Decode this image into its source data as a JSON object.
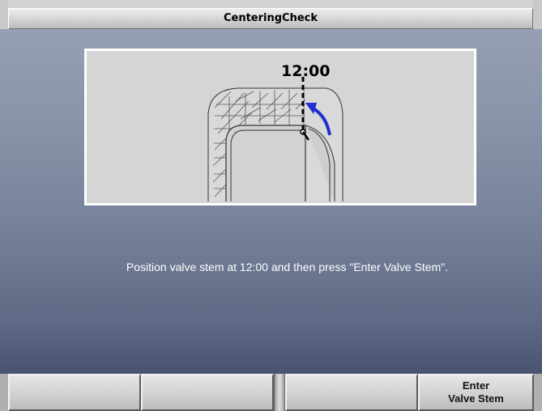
{
  "window": {
    "title": "CenteringCheck"
  },
  "illustration": {
    "clock_label": "12:00",
    "arrow_color": "#1f2fd0",
    "icon": "tire-valve-stem-diagram"
  },
  "instruction": {
    "text": "Position valve stem at 12:00 and then press \"Enter Valve Stem\"."
  },
  "softkeys": [
    {
      "line1": "",
      "line2": ""
    },
    {
      "line1": "",
      "line2": ""
    },
    {
      "line1": "",
      "line2": ""
    },
    {
      "line1": "Enter",
      "line2": "Valve Stem"
    }
  ]
}
